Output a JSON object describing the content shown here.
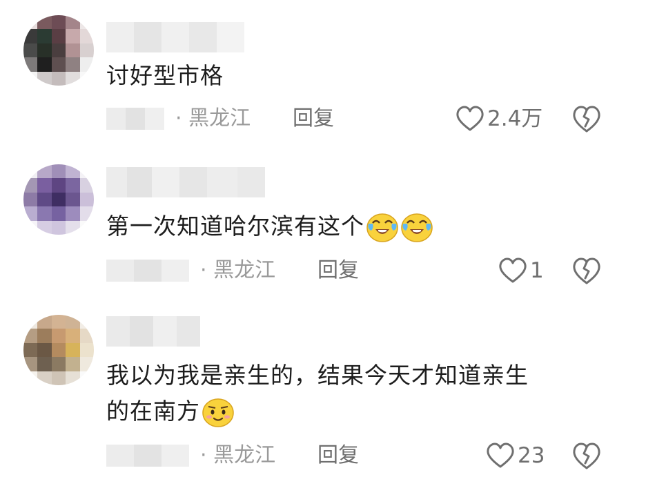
{
  "comments": [
    {
      "text": "讨好型市格",
      "location": "黑龙江",
      "separator": "·",
      "reply_label": "回复",
      "like_count": "2.4万"
    },
    {
      "text": "第一次知道哈尔滨有这个",
      "emojis": [
        "crying-laughing-emoji",
        "crying-laughing-emoji"
      ],
      "location": "黑龙江",
      "separator": "·",
      "reply_label": "回复",
      "like_count": "1"
    },
    {
      "text_line1": "我以为我是亲生的，结果今天才知道亲生",
      "text_line2": "的在南方",
      "emojis": [
        "shy-smile-emoji"
      ],
      "location": "黑龙江",
      "separator": "·",
      "reply_label": "回复",
      "like_count": "23"
    }
  ],
  "icons": {
    "like": "heart-outline-icon",
    "dislike": "broken-heart-icon"
  },
  "colors": {
    "text": "#1d1d1d",
    "meta": "#9a9a9a",
    "icon": "#6f6f6f"
  }
}
